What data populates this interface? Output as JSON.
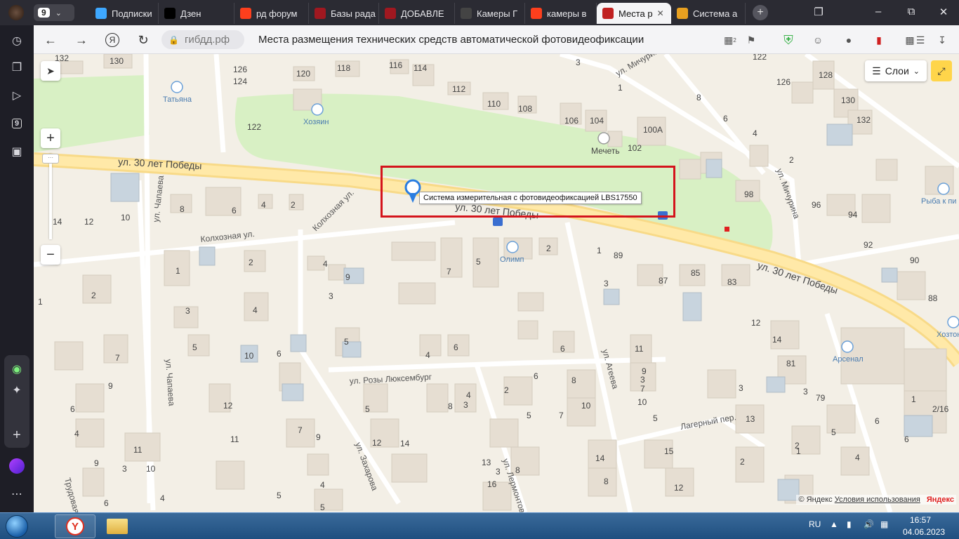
{
  "browser": {
    "tab_counter": "9",
    "tabs": [
      {
        "label": "Подписки",
        "favicon": "subscriptions-icon",
        "color": "#3ea8ff"
      },
      {
        "label": "Дзен",
        "favicon": "dzen-icon",
        "color": "#000000"
      },
      {
        "label": "рд форум",
        "favicon": "yandex-icon",
        "color": "#fc3f1d"
      },
      {
        "label": "Базы рада",
        "favicon": "radar-icon",
        "color": "#a01820"
      },
      {
        "label": "ДОБАВЛЕ",
        "favicon": "radar-icon",
        "color": "#a01820"
      },
      {
        "label": "Камеры Г",
        "favicon": "camera-icon",
        "color": "#444444"
      },
      {
        "label": "камеры в",
        "favicon": "yandex-icon",
        "color": "#fc3f1d"
      },
      {
        "label": "Места р",
        "favicon": "gibdd-icon",
        "color": "#c02020",
        "active": true
      },
      {
        "label": "Система а",
        "favicon": "system-icon",
        "color": "#e8a020"
      }
    ],
    "address": {
      "domain": "гибдд.рф",
      "title": "Места размещения технических средств автоматической фотовидеофиксации",
      "yandex_letter": "Я",
      "extension_badge": "2"
    }
  },
  "map": {
    "layers_label": "Слои",
    "tooltip": "Система измерительная с фотовидеофиксацией LBS17550",
    "copyright": "© Яндекс",
    "terms_link": "Условия использования",
    "brand": "Яндекс",
    "streets": {
      "main_west": "ул. 30 лет Победы",
      "main_center": "ул. 30 лет Победы",
      "main_east": "ул. 30 лет Победы",
      "michurina_n": "ул. Мичурина",
      "michurina_s": "ул. Мичурина",
      "kolkhoznaya": "Колхозная ул.",
      "kolkhoznaya2": "Колхозная ул.",
      "chapaeva_n": "ул. Чапаева",
      "chapaeva_s": "ул. Чапаева",
      "rozy": "ул. Розы Люксембург",
      "ageeva": "ул. Агеева",
      "zakharova": "ул. Захарова",
      "lermontova": "ул. Лермонтова",
      "lagerny": "Лагерный пер.",
      "trudovaya": "Трудовая"
    },
    "pois": {
      "tatyana": "Татьяна",
      "khozyain": "Хозяин",
      "mechet": "Мечеть",
      "olimp": "Олимп",
      "ryba": "Рыба к пи",
      "khozton": "Хозтон",
      "arsenal": "Арсенал"
    },
    "house_numbers": [
      "132",
      "130",
      "126",
      "124",
      "120",
      "118",
      "116",
      "114",
      "112",
      "110",
      "108",
      "106",
      "104",
      "100А",
      "102",
      "3",
      "1",
      "122",
      "128",
      "126",
      "8",
      "6",
      "4",
      "130",
      "132",
      "2",
      "98",
      "96",
      "94",
      "92",
      "90",
      "88",
      "122",
      "8",
      "6",
      "4",
      "2",
      "14",
      "12",
      "10",
      "1",
      "2",
      "7",
      "5",
      "2",
      "1",
      "89",
      "87",
      "85",
      "83",
      "3",
      "4",
      "3",
      "2",
      "1",
      "9",
      "4",
      "3",
      "5",
      "5",
      "10",
      "6",
      "4",
      "6",
      "6",
      "7",
      "9",
      "11",
      "3",
      "5",
      "2",
      "4",
      "6",
      "8",
      "10",
      "12",
      "14",
      "81",
      "3",
      "79",
      "5",
      "4",
      "6",
      "2/16",
      "1",
      "3",
      "13",
      "15",
      "12",
      "14",
      "8",
      "10",
      "9",
      "7",
      "5",
      "3",
      "7",
      "5",
      "8",
      "6",
      "4",
      "9",
      "11",
      "12",
      "3",
      "10",
      "7",
      "9",
      "11",
      "12",
      "14",
      "13",
      "16",
      "8",
      "6",
      "4",
      "5",
      "5",
      "4",
      "3",
      "2",
      "2",
      "1",
      "6"
    ]
  },
  "taskbar": {
    "lang": "RU",
    "time": "16:57",
    "date": "04.06.2023"
  }
}
